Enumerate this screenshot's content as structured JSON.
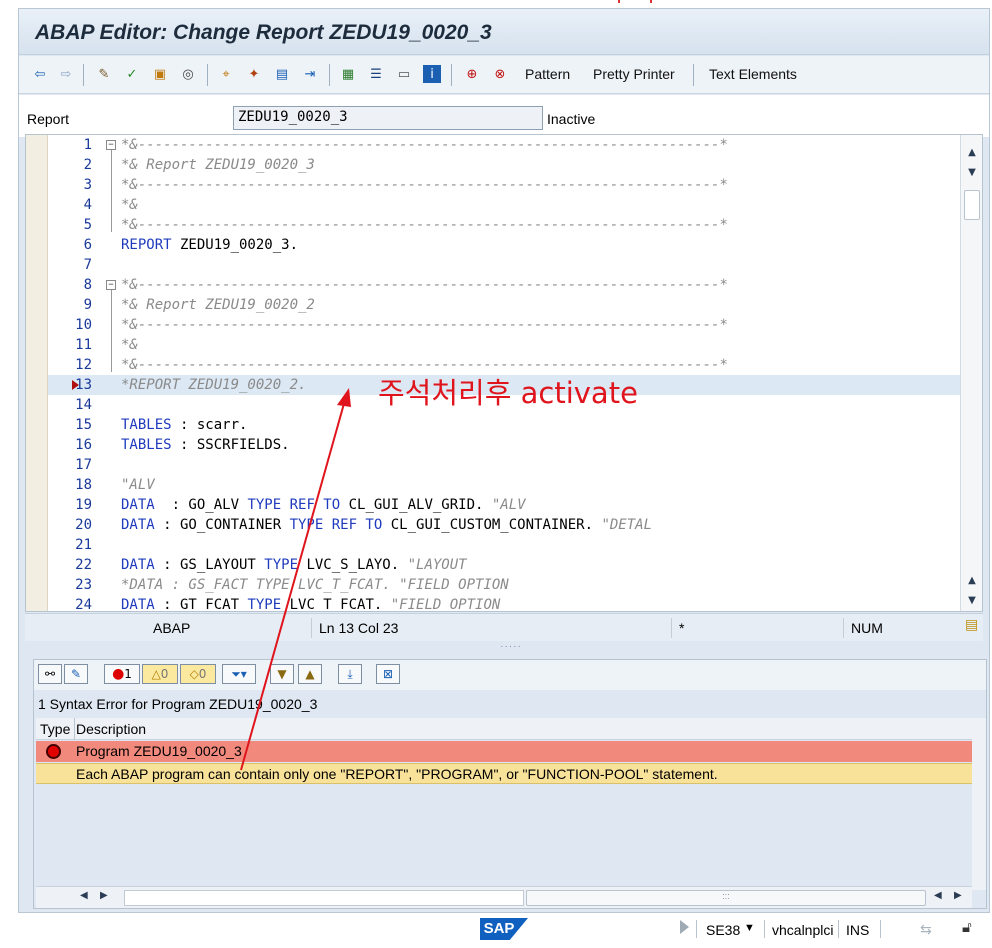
{
  "window": {
    "title": "ABAP Editor: Change Report ZEDU19_0020_3"
  },
  "toolbar": {
    "icons": [
      "back-icon",
      "forward-icon",
      "edit-toggle-icon",
      "check-icon",
      "activate-icon",
      "test-icon",
      "where-used-icon",
      "object-list-icon",
      "display-object-list-icon",
      "navigation-window-icon",
      "hierarchy-icon",
      "breakpoint-icon",
      "help-icon",
      "info-icon",
      "set-breakpoint-icon",
      "external-breakpoint-icon"
    ],
    "pattern_label": "Pattern",
    "pretty_printer_label": "Pretty Printer",
    "text_elements_label": "Text Elements"
  },
  "report": {
    "label": "Report",
    "name": "ZEDU19_0020_3",
    "status": "Inactive"
  },
  "editor": {
    "lines": [
      {
        "n": "1",
        "text": "*&---------------------------------------------------------------------*",
        "style": "comment"
      },
      {
        "n": "2",
        "text": "*& Report ZEDU19_0020_3",
        "style": "comment"
      },
      {
        "n": "3",
        "text": "*&---------------------------------------------------------------------*",
        "style": "comment"
      },
      {
        "n": "4",
        "text": "*&",
        "style": "comment"
      },
      {
        "n": "5",
        "text": "*&---------------------------------------------------------------------*",
        "style": "comment"
      },
      {
        "n": "6",
        "kw": "REPORT",
        "rest": " ZEDU19_0020_3.",
        "style": "code"
      },
      {
        "n": "7",
        "text": "",
        "style": "code"
      },
      {
        "n": "8",
        "text": "*&---------------------------------------------------------------------*",
        "style": "comment"
      },
      {
        "n": "9",
        "text": "*& Report ZEDU19_0020_2",
        "style": "comment"
      },
      {
        "n": "10",
        "text": "*&---------------------------------------------------------------------*",
        "style": "comment"
      },
      {
        "n": "11",
        "text": "*&",
        "style": "comment"
      },
      {
        "n": "12",
        "text": "*&---------------------------------------------------------------------*",
        "style": "comment"
      },
      {
        "n": "13",
        "text": "*REPORT ZEDU19_0020_2.",
        "style": "comment"
      },
      {
        "n": "14",
        "text": "",
        "style": "code"
      },
      {
        "n": "15",
        "kw": "TABLES",
        "rest": " : scarr.",
        "style": "code"
      },
      {
        "n": "16",
        "kw": "TABLES",
        "rest": " : SSCRFIELDS.",
        "style": "code"
      },
      {
        "n": "17",
        "text": "",
        "style": "code"
      },
      {
        "n": "18",
        "text": "\"ALV",
        "style": "comment"
      },
      {
        "n": "19",
        "raw": "data19",
        "style": "rich"
      },
      {
        "n": "20",
        "raw": "data20",
        "style": "rich"
      },
      {
        "n": "21",
        "text": "",
        "style": "code"
      },
      {
        "n": "22",
        "raw": "data22",
        "style": "rich"
      },
      {
        "n": "23",
        "text": "*DATA : GS_FACT TYPE LVC_T_FCAT. \"FIELD OPTION",
        "style": "comment"
      },
      {
        "n": "24",
        "raw": "data24",
        "style": "rich"
      }
    ],
    "rich": {
      "data19": [
        [
          "kw",
          "DATA"
        ],
        [
          "",
          "  : GO_ALV "
        ],
        [
          "kw",
          "TYPE REF TO"
        ],
        [
          "",
          " CL_GUI_ALV_GRID. "
        ],
        [
          "cm",
          "\"ALV"
        ]
      ],
      "data20": [
        [
          "kw",
          "DATA"
        ],
        [
          "",
          " : GO_CONTAINER "
        ],
        [
          "kw",
          "TYPE REF TO"
        ],
        [
          "",
          " CL_GUI_CUSTOM_CONTAINER. "
        ],
        [
          "cm",
          "\"DETAL"
        ]
      ],
      "data22": [
        [
          "kw",
          "DATA"
        ],
        [
          "",
          " : GS_LAYOUT "
        ],
        [
          "kw",
          "TYPE"
        ],
        [
          "",
          " LVC_S_LAYO. "
        ],
        [
          "cm",
          "\"LAYOUT"
        ]
      ],
      "data24": [
        [
          "kw",
          "DATA"
        ],
        [
          "",
          " : GT_FCAT "
        ],
        [
          "kw",
          "TYPE"
        ],
        [
          "",
          " LVC_T_FCAT. "
        ],
        [
          "cm",
          "\"FIELD OPTION"
        ]
      ]
    },
    "highlighted_line": 13
  },
  "status_line": {
    "language": "ABAP",
    "position": "Ln  13 Col  23",
    "modified": "*",
    "mode": "NUM"
  },
  "error_panel": {
    "toolbar_counts": {
      "errors": "1",
      "warnings": "0",
      "infos": "0"
    },
    "title": "1 Syntax Error for Program ZEDU19_0020_3",
    "columns": {
      "type": "Type",
      "description": "Description"
    },
    "rows": [
      {
        "type": "error-icon",
        "description": "Program ZEDU19_0020_3"
      },
      {
        "type": "",
        "description": "Each ABAP program can contain only one \"REPORT\", \"PROGRAM\", or \"FUNCTION-POOL\" statement."
      }
    ]
  },
  "status_bar": {
    "logo": "SAP",
    "transaction": "SE38",
    "server": "vhcalnplci",
    "insert_mode": "INS"
  },
  "annotation": {
    "text": "주석처리후 activate",
    "color": "#e0141c"
  },
  "colors": {
    "keyword": "#1f3bbd",
    "comment": "#8a8a8a",
    "error_row": "#f2897d",
    "message_row": "#f8e29a"
  }
}
